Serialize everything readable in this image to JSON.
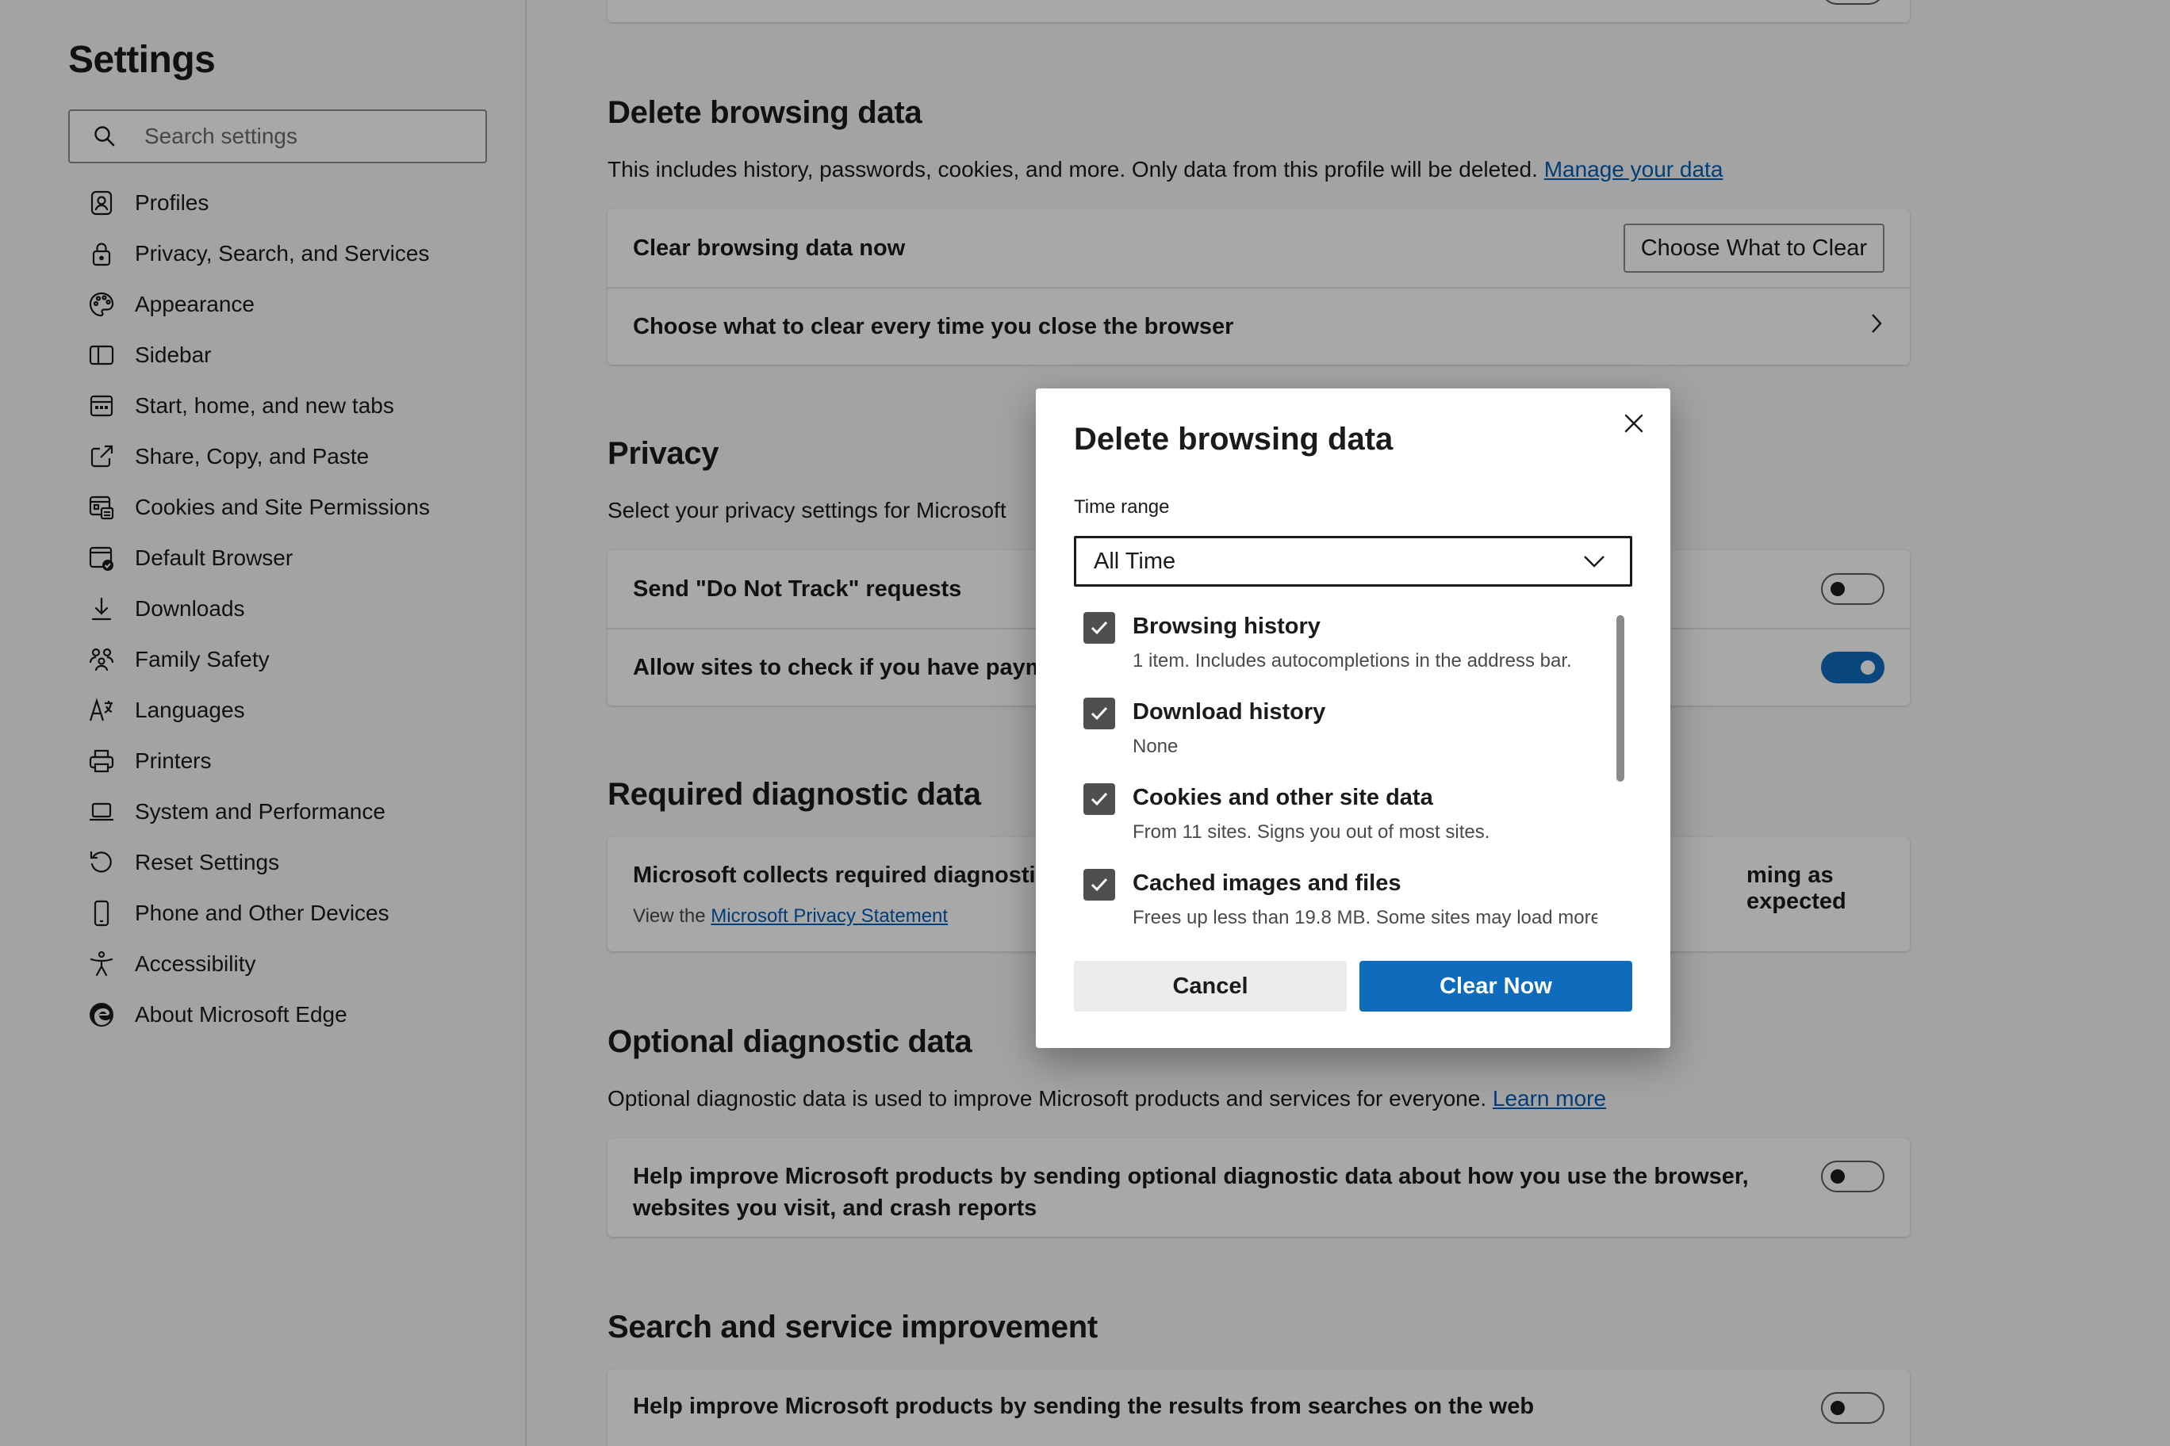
{
  "sidebar": {
    "title": "Settings",
    "search_placeholder": "Search settings",
    "items": [
      {
        "label": "Profiles",
        "icon": "profile-icon"
      },
      {
        "label": "Privacy, Search, and Services",
        "icon": "lock-icon"
      },
      {
        "label": "Appearance",
        "icon": "palette-icon"
      },
      {
        "label": "Sidebar",
        "icon": "sidebar-icon"
      },
      {
        "label": "Start, home, and new tabs",
        "icon": "home-tabs-icon"
      },
      {
        "label": "Share, Copy, and Paste",
        "icon": "share-icon"
      },
      {
        "label": "Cookies and Site Permissions",
        "icon": "cookies-icon"
      },
      {
        "label": "Default Browser",
        "icon": "default-browser-icon"
      },
      {
        "label": "Downloads",
        "icon": "download-icon"
      },
      {
        "label": "Family Safety",
        "icon": "family-icon"
      },
      {
        "label": "Languages",
        "icon": "languages-icon"
      },
      {
        "label": "Printers",
        "icon": "printer-icon"
      },
      {
        "label": "System and Performance",
        "icon": "laptop-icon"
      },
      {
        "label": "Reset Settings",
        "icon": "reset-icon"
      },
      {
        "label": "Phone and Other Devices",
        "icon": "phone-icon"
      },
      {
        "label": "Accessibility",
        "icon": "accessibility-icon"
      },
      {
        "label": "About Microsoft Edge",
        "icon": "edge-icon"
      }
    ]
  },
  "main": {
    "delete_section": {
      "title": "Delete browsing data",
      "desc": "This includes history, passwords, cookies, and more. Only data from this profile will be deleted.",
      "desc_link": "Manage your data",
      "row1_label": "Clear browsing data now",
      "row1_button": "Choose What to Clear",
      "row2_label": "Choose what to clear every time you close the browser"
    },
    "privacy_section": {
      "title": "Privacy",
      "desc": "Select your privacy settings for Microsoft",
      "row1_label": "Send \"Do Not Track\" requests",
      "row1_toggle": "off",
      "row2_label": "Allow sites to check if you have payme",
      "row2_toggle": "on"
    },
    "required_section": {
      "title": "Required diagnostic data",
      "row_label_left": "Microsoft collects required diagnostic",
      "row_label_right": "ming as expected",
      "view_prefix": "View the",
      "view_link": "Microsoft Privacy Statement"
    },
    "optional_section": {
      "title": "Optional diagnostic data",
      "desc": "Optional diagnostic data is used to improve Microsoft products and services for everyone.",
      "desc_link": "Learn more",
      "row_label_line1": "Help improve Microsoft products by sending optional diagnostic data about how you use the browser,",
      "row_label_line2": "websites you visit, and crash reports",
      "row_toggle": "off"
    },
    "search_section": {
      "title": "Search and service improvement",
      "row_label": "Help improve Microsoft products by sending the results from searches on the web",
      "row_toggle": "off"
    }
  },
  "dialog": {
    "title": "Delete browsing data",
    "time_range_label": "Time range",
    "time_range_value": "All Time",
    "items": [
      {
        "title": "Browsing history",
        "desc": "1 item. Includes autocompletions in the address bar.",
        "checked": true
      },
      {
        "title": "Download history",
        "desc": "None",
        "checked": true
      },
      {
        "title": "Cookies and other site data",
        "desc": "From 11 sites. Signs you out of most sites.",
        "checked": true
      },
      {
        "title": "Cached images and files",
        "desc": "Frees up less than 19.8 MB. Some sites may load more",
        "checked": true
      }
    ],
    "cancel_label": "Cancel",
    "confirm_label": "Clear Now"
  },
  "colors": {
    "accent": "#0f6cbd",
    "link": "#005fb8",
    "checkbox": "#4f4f4f"
  }
}
